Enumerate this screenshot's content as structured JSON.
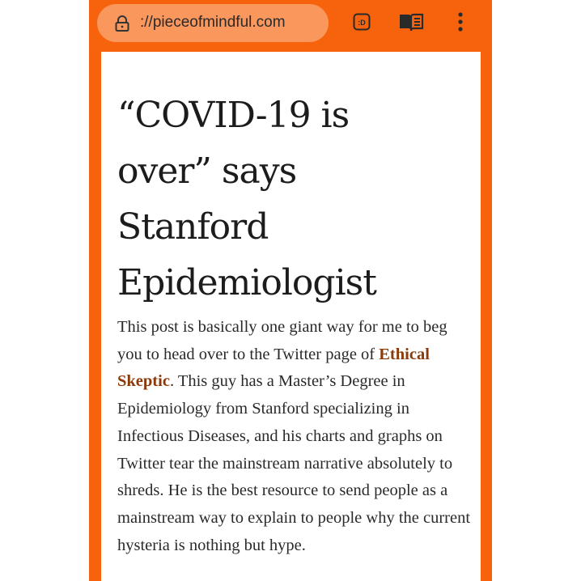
{
  "browser": {
    "url": "://pieceofmindful.com",
    "icons": [
      "lock-icon",
      "reader-mode-icon",
      "book-icon",
      "more-vert-icon"
    ],
    "reader_icon_text": ":D",
    "accent": "#f7630c"
  },
  "article": {
    "title_lines": [
      "“COVID-19 is",
      "over” says",
      "Stanford",
      "Epidemiologist"
    ],
    "paragraph_before_link": "This post is basically one giant way for me to beg you to head over to the Twitter page of ",
    "link_text": "Ethical Skeptic",
    "paragraph_after_link": ". This guy has a Master’s Degree in Epidemiology from Stanford specializing in Infectious Diseases, and his charts and graphs on Twitter tear the mainstream narrative absolutely to shreds. He is the best resource to send people as a mainstream way to explain to people why the current hysteria is nothing but hype.",
    "link_color": "#8b3a0a"
  }
}
